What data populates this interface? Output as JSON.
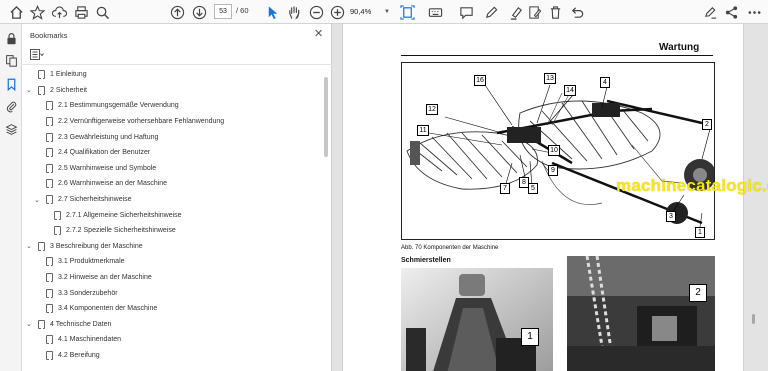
{
  "toolbar": {
    "page_current": "53",
    "page_total": "/ 60",
    "zoom": "90,4%"
  },
  "panel": {
    "title": "Bookmarks",
    "close_label": "✕",
    "items": [
      {
        "label": "1 Einleitung",
        "level": 0,
        "expandable": false,
        "expanded": false
      },
      {
        "label": "2 Sicherheit",
        "level": 0,
        "expandable": true,
        "expanded": true
      },
      {
        "label": "2.1 Bestimmungsgemäße Verwendung",
        "level": 1,
        "expandable": false,
        "expanded": false
      },
      {
        "label": "2.2 Vernünftigerweise vorhersehbare Fehlanwendung",
        "level": 1,
        "expandable": false,
        "expanded": false
      },
      {
        "label": "2.3 Gewährleistung und Haftung",
        "level": 1,
        "expandable": false,
        "expanded": false
      },
      {
        "label": "2.4 Qualifikation der Benutzer",
        "level": 1,
        "expandable": false,
        "expanded": false
      },
      {
        "label": "2.5 Warnhinweise und Symbole",
        "level": 1,
        "expandable": false,
        "expanded": false
      },
      {
        "label": "2.6 Warnhinweise an der Maschine",
        "level": 1,
        "expandable": false,
        "expanded": false
      },
      {
        "label": "2.7  Sicherheitshinweise",
        "level": 1,
        "expandable": true,
        "expanded": true
      },
      {
        "label": "2.7.1 Allgemeine Sicherheitshinweise",
        "level": 2,
        "expandable": false,
        "expanded": false
      },
      {
        "label": "2.7.2 Spezielle Sicherheitshinweise",
        "level": 2,
        "expandable": false,
        "expanded": false
      },
      {
        "label": "3 Beschreibung der Maschine",
        "level": 0,
        "expandable": true,
        "expanded": true
      },
      {
        "label": "3.1 Produktmerkmale",
        "level": 1,
        "expandable": false,
        "expanded": false
      },
      {
        "label": "3.2 Hinweise an der Maschine",
        "level": 1,
        "expandable": false,
        "expanded": false
      },
      {
        "label": "3.3 Sonderzubehör",
        "level": 1,
        "expandable": false,
        "expanded": false
      },
      {
        "label": "3.4 Komponenten der Maschine",
        "level": 1,
        "expandable": false,
        "expanded": false
      },
      {
        "label": "4 Technische Daten",
        "level": 0,
        "expandable": true,
        "expanded": true
      },
      {
        "label": "4.1 Maschinendaten",
        "level": 1,
        "expandable": false,
        "expanded": false
      },
      {
        "label": "4.2 Bereifung",
        "level": 1,
        "expandable": false,
        "expanded": false
      }
    ]
  },
  "document": {
    "section_title": "Wartung",
    "figure_caption": "Abb. 70   Komponenten der Maschine",
    "subheading": "Schmierstellen",
    "callouts": [
      "16",
      "13",
      "4",
      "14",
      "12",
      "2",
      "11",
      "10",
      "9",
      "8",
      "7",
      "5",
      "3",
      "1"
    ],
    "photo1_callout": "1",
    "photo2_callout": "2",
    "watermark": "machinecatalogic.com"
  },
  "icons": {
    "toolbar": [
      "home-icon",
      "bookmark-star-icon",
      "upload-cloud-icon",
      "print-icon",
      "search-icon",
      "page-up-icon",
      "page-down-icon",
      "select-cursor-icon",
      "hand-pan-icon",
      "zoom-out-icon",
      "zoom-in-icon",
      "fit-page-icon",
      "keyboard-icon",
      "comment-icon",
      "pen-icon",
      "highlight-icon",
      "delete-icon",
      "more-icon",
      "pen-sign-icon",
      "share-icon"
    ],
    "rail": [
      "lock-icon",
      "pages-icon",
      "bookmarks-icon",
      "attachment-icon",
      "layers-icon"
    ]
  },
  "colors": {
    "accent": "#1473e6",
    "watermark": "#fde800"
  }
}
